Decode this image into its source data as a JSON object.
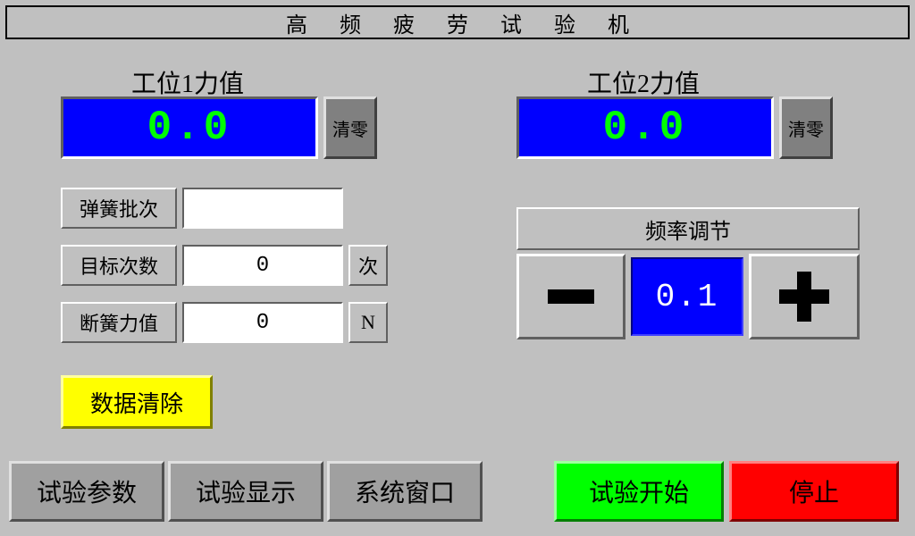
{
  "title": "高频疲劳试验机",
  "station1": {
    "label": "工位1力值",
    "value": "0.0",
    "clear_btn": "清零"
  },
  "station2": {
    "label": "工位2力值",
    "value": "0.0",
    "clear_btn": "清零"
  },
  "params": {
    "spring_batch": {
      "label": "弹簧批次",
      "value": ""
    },
    "target_count": {
      "label": "目标次数",
      "value": "0",
      "unit": "次"
    },
    "break_force": {
      "label": "断簧力值",
      "value": "0",
      "unit": "N"
    }
  },
  "data_clear_btn": "数据清除",
  "frequency": {
    "label": "频率调节",
    "value": "0.1"
  },
  "bottom_nav": {
    "test_params": "试验参数",
    "test_display": "试验显示",
    "system_window": "系统窗口",
    "start": "试验开始",
    "stop": "停止"
  }
}
